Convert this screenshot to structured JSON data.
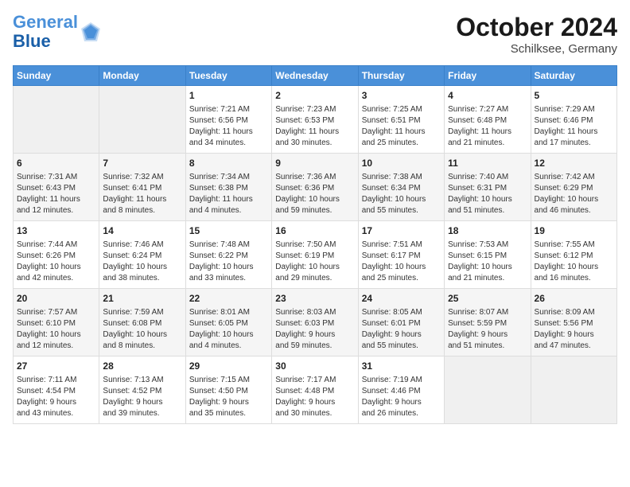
{
  "header": {
    "logo_line1": "General",
    "logo_line2": "Blue",
    "month": "October 2024",
    "location": "Schilksee, Germany"
  },
  "weekdays": [
    "Sunday",
    "Monday",
    "Tuesday",
    "Wednesday",
    "Thursday",
    "Friday",
    "Saturday"
  ],
  "weeks": [
    [
      {
        "day": "",
        "info": ""
      },
      {
        "day": "",
        "info": ""
      },
      {
        "day": "1",
        "info": "Sunrise: 7:21 AM\nSunset: 6:56 PM\nDaylight: 11 hours\nand 34 minutes."
      },
      {
        "day": "2",
        "info": "Sunrise: 7:23 AM\nSunset: 6:53 PM\nDaylight: 11 hours\nand 30 minutes."
      },
      {
        "day": "3",
        "info": "Sunrise: 7:25 AM\nSunset: 6:51 PM\nDaylight: 11 hours\nand 25 minutes."
      },
      {
        "day": "4",
        "info": "Sunrise: 7:27 AM\nSunset: 6:48 PM\nDaylight: 11 hours\nand 21 minutes."
      },
      {
        "day": "5",
        "info": "Sunrise: 7:29 AM\nSunset: 6:46 PM\nDaylight: 11 hours\nand 17 minutes."
      }
    ],
    [
      {
        "day": "6",
        "info": "Sunrise: 7:31 AM\nSunset: 6:43 PM\nDaylight: 11 hours\nand 12 minutes."
      },
      {
        "day": "7",
        "info": "Sunrise: 7:32 AM\nSunset: 6:41 PM\nDaylight: 11 hours\nand 8 minutes."
      },
      {
        "day": "8",
        "info": "Sunrise: 7:34 AM\nSunset: 6:38 PM\nDaylight: 11 hours\nand 4 minutes."
      },
      {
        "day": "9",
        "info": "Sunrise: 7:36 AM\nSunset: 6:36 PM\nDaylight: 10 hours\nand 59 minutes."
      },
      {
        "day": "10",
        "info": "Sunrise: 7:38 AM\nSunset: 6:34 PM\nDaylight: 10 hours\nand 55 minutes."
      },
      {
        "day": "11",
        "info": "Sunrise: 7:40 AM\nSunset: 6:31 PM\nDaylight: 10 hours\nand 51 minutes."
      },
      {
        "day": "12",
        "info": "Sunrise: 7:42 AM\nSunset: 6:29 PM\nDaylight: 10 hours\nand 46 minutes."
      }
    ],
    [
      {
        "day": "13",
        "info": "Sunrise: 7:44 AM\nSunset: 6:26 PM\nDaylight: 10 hours\nand 42 minutes."
      },
      {
        "day": "14",
        "info": "Sunrise: 7:46 AM\nSunset: 6:24 PM\nDaylight: 10 hours\nand 38 minutes."
      },
      {
        "day": "15",
        "info": "Sunrise: 7:48 AM\nSunset: 6:22 PM\nDaylight: 10 hours\nand 33 minutes."
      },
      {
        "day": "16",
        "info": "Sunrise: 7:50 AM\nSunset: 6:19 PM\nDaylight: 10 hours\nand 29 minutes."
      },
      {
        "day": "17",
        "info": "Sunrise: 7:51 AM\nSunset: 6:17 PM\nDaylight: 10 hours\nand 25 minutes."
      },
      {
        "day": "18",
        "info": "Sunrise: 7:53 AM\nSunset: 6:15 PM\nDaylight: 10 hours\nand 21 minutes."
      },
      {
        "day": "19",
        "info": "Sunrise: 7:55 AM\nSunset: 6:12 PM\nDaylight: 10 hours\nand 16 minutes."
      }
    ],
    [
      {
        "day": "20",
        "info": "Sunrise: 7:57 AM\nSunset: 6:10 PM\nDaylight: 10 hours\nand 12 minutes."
      },
      {
        "day": "21",
        "info": "Sunrise: 7:59 AM\nSunset: 6:08 PM\nDaylight: 10 hours\nand 8 minutes."
      },
      {
        "day": "22",
        "info": "Sunrise: 8:01 AM\nSunset: 6:05 PM\nDaylight: 10 hours\nand 4 minutes."
      },
      {
        "day": "23",
        "info": "Sunrise: 8:03 AM\nSunset: 6:03 PM\nDaylight: 9 hours\nand 59 minutes."
      },
      {
        "day": "24",
        "info": "Sunrise: 8:05 AM\nSunset: 6:01 PM\nDaylight: 9 hours\nand 55 minutes."
      },
      {
        "day": "25",
        "info": "Sunrise: 8:07 AM\nSunset: 5:59 PM\nDaylight: 9 hours\nand 51 minutes."
      },
      {
        "day": "26",
        "info": "Sunrise: 8:09 AM\nSunset: 5:56 PM\nDaylight: 9 hours\nand 47 minutes."
      }
    ],
    [
      {
        "day": "27",
        "info": "Sunrise: 7:11 AM\nSunset: 4:54 PM\nDaylight: 9 hours\nand 43 minutes."
      },
      {
        "day": "28",
        "info": "Sunrise: 7:13 AM\nSunset: 4:52 PM\nDaylight: 9 hours\nand 39 minutes."
      },
      {
        "day": "29",
        "info": "Sunrise: 7:15 AM\nSunset: 4:50 PM\nDaylight: 9 hours\nand 35 minutes."
      },
      {
        "day": "30",
        "info": "Sunrise: 7:17 AM\nSunset: 4:48 PM\nDaylight: 9 hours\nand 30 minutes."
      },
      {
        "day": "31",
        "info": "Sunrise: 7:19 AM\nSunset: 4:46 PM\nDaylight: 9 hours\nand 26 minutes."
      },
      {
        "day": "",
        "info": ""
      },
      {
        "day": "",
        "info": ""
      }
    ]
  ]
}
